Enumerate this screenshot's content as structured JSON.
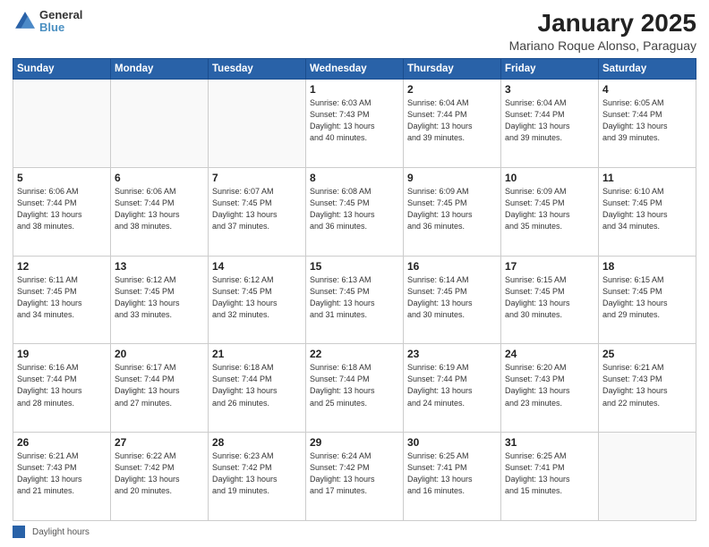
{
  "header": {
    "logo_line1": "General",
    "logo_line2": "Blue",
    "month": "January 2025",
    "location": "Mariano Roque Alonso, Paraguay"
  },
  "days_of_week": [
    "Sunday",
    "Monday",
    "Tuesday",
    "Wednesday",
    "Thursday",
    "Friday",
    "Saturday"
  ],
  "legend_label": "Daylight hours",
  "weeks": [
    [
      {
        "num": "",
        "info": ""
      },
      {
        "num": "",
        "info": ""
      },
      {
        "num": "",
        "info": ""
      },
      {
        "num": "1",
        "info": "Sunrise: 6:03 AM\nSunset: 7:43 PM\nDaylight: 13 hours\nand 40 minutes."
      },
      {
        "num": "2",
        "info": "Sunrise: 6:04 AM\nSunset: 7:44 PM\nDaylight: 13 hours\nand 39 minutes."
      },
      {
        "num": "3",
        "info": "Sunrise: 6:04 AM\nSunset: 7:44 PM\nDaylight: 13 hours\nand 39 minutes."
      },
      {
        "num": "4",
        "info": "Sunrise: 6:05 AM\nSunset: 7:44 PM\nDaylight: 13 hours\nand 39 minutes."
      }
    ],
    [
      {
        "num": "5",
        "info": "Sunrise: 6:06 AM\nSunset: 7:44 PM\nDaylight: 13 hours\nand 38 minutes."
      },
      {
        "num": "6",
        "info": "Sunrise: 6:06 AM\nSunset: 7:44 PM\nDaylight: 13 hours\nand 38 minutes."
      },
      {
        "num": "7",
        "info": "Sunrise: 6:07 AM\nSunset: 7:45 PM\nDaylight: 13 hours\nand 37 minutes."
      },
      {
        "num": "8",
        "info": "Sunrise: 6:08 AM\nSunset: 7:45 PM\nDaylight: 13 hours\nand 36 minutes."
      },
      {
        "num": "9",
        "info": "Sunrise: 6:09 AM\nSunset: 7:45 PM\nDaylight: 13 hours\nand 36 minutes."
      },
      {
        "num": "10",
        "info": "Sunrise: 6:09 AM\nSunset: 7:45 PM\nDaylight: 13 hours\nand 35 minutes."
      },
      {
        "num": "11",
        "info": "Sunrise: 6:10 AM\nSunset: 7:45 PM\nDaylight: 13 hours\nand 34 minutes."
      }
    ],
    [
      {
        "num": "12",
        "info": "Sunrise: 6:11 AM\nSunset: 7:45 PM\nDaylight: 13 hours\nand 34 minutes."
      },
      {
        "num": "13",
        "info": "Sunrise: 6:12 AM\nSunset: 7:45 PM\nDaylight: 13 hours\nand 33 minutes."
      },
      {
        "num": "14",
        "info": "Sunrise: 6:12 AM\nSunset: 7:45 PM\nDaylight: 13 hours\nand 32 minutes."
      },
      {
        "num": "15",
        "info": "Sunrise: 6:13 AM\nSunset: 7:45 PM\nDaylight: 13 hours\nand 31 minutes."
      },
      {
        "num": "16",
        "info": "Sunrise: 6:14 AM\nSunset: 7:45 PM\nDaylight: 13 hours\nand 30 minutes."
      },
      {
        "num": "17",
        "info": "Sunrise: 6:15 AM\nSunset: 7:45 PM\nDaylight: 13 hours\nand 30 minutes."
      },
      {
        "num": "18",
        "info": "Sunrise: 6:15 AM\nSunset: 7:45 PM\nDaylight: 13 hours\nand 29 minutes."
      }
    ],
    [
      {
        "num": "19",
        "info": "Sunrise: 6:16 AM\nSunset: 7:44 PM\nDaylight: 13 hours\nand 28 minutes."
      },
      {
        "num": "20",
        "info": "Sunrise: 6:17 AM\nSunset: 7:44 PM\nDaylight: 13 hours\nand 27 minutes."
      },
      {
        "num": "21",
        "info": "Sunrise: 6:18 AM\nSunset: 7:44 PM\nDaylight: 13 hours\nand 26 minutes."
      },
      {
        "num": "22",
        "info": "Sunrise: 6:18 AM\nSunset: 7:44 PM\nDaylight: 13 hours\nand 25 minutes."
      },
      {
        "num": "23",
        "info": "Sunrise: 6:19 AM\nSunset: 7:44 PM\nDaylight: 13 hours\nand 24 minutes."
      },
      {
        "num": "24",
        "info": "Sunrise: 6:20 AM\nSunset: 7:43 PM\nDaylight: 13 hours\nand 23 minutes."
      },
      {
        "num": "25",
        "info": "Sunrise: 6:21 AM\nSunset: 7:43 PM\nDaylight: 13 hours\nand 22 minutes."
      }
    ],
    [
      {
        "num": "26",
        "info": "Sunrise: 6:21 AM\nSunset: 7:43 PM\nDaylight: 13 hours\nand 21 minutes."
      },
      {
        "num": "27",
        "info": "Sunrise: 6:22 AM\nSunset: 7:42 PM\nDaylight: 13 hours\nand 20 minutes."
      },
      {
        "num": "28",
        "info": "Sunrise: 6:23 AM\nSunset: 7:42 PM\nDaylight: 13 hours\nand 19 minutes."
      },
      {
        "num": "29",
        "info": "Sunrise: 6:24 AM\nSunset: 7:42 PM\nDaylight: 13 hours\nand 17 minutes."
      },
      {
        "num": "30",
        "info": "Sunrise: 6:25 AM\nSunset: 7:41 PM\nDaylight: 13 hours\nand 16 minutes."
      },
      {
        "num": "31",
        "info": "Sunrise: 6:25 AM\nSunset: 7:41 PM\nDaylight: 13 hours\nand 15 minutes."
      },
      {
        "num": "",
        "info": ""
      }
    ]
  ]
}
